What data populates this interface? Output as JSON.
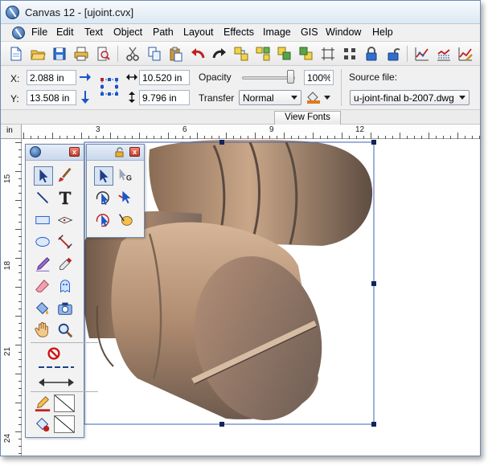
{
  "window": {
    "title": "Canvas 12 - [ujoint.cvx]"
  },
  "menu": [
    "File",
    "Edit",
    "Text",
    "Object",
    "Path",
    "Layout",
    "Effects",
    "Image",
    "GIS",
    "Window",
    "Help"
  ],
  "toolbar": {
    "buttons": [
      "new-document",
      "open",
      "save",
      "print",
      "print-preview",
      "cut",
      "copy",
      "paste",
      "undo",
      "redo",
      "group",
      "ungroup",
      "lock",
      "unlock",
      "align",
      "distribute",
      "lock-object",
      "unlock-object",
      "chart",
      "chart-sheet",
      "chart-edit"
    ]
  },
  "properties": {
    "x_label": "X:",
    "x_value": "2.088 in",
    "y_label": "Y:",
    "y_value": "13.508 in",
    "width_value": "10.520 in",
    "height_value": "9.796 in",
    "opacity_label": "Opacity",
    "opacity_value": "100%",
    "opacity_level": 1.0,
    "transfer_label": "Transfer",
    "transfer_value": "Normal",
    "source_label": "Source file:",
    "source_value": "u-joint-final b-2007.dwg"
  },
  "view_fonts_tab": "View Fonts",
  "rulers": {
    "unit": "in",
    "h_numbers": [
      "3",
      "6",
      "9",
      "12"
    ],
    "v_numbers": [
      "15",
      "18",
      "21",
      "24"
    ]
  },
  "colors": {
    "accent_blue": "#1c56c8",
    "selection_box": "#3a63b8",
    "pipe": "#b89478"
  }
}
